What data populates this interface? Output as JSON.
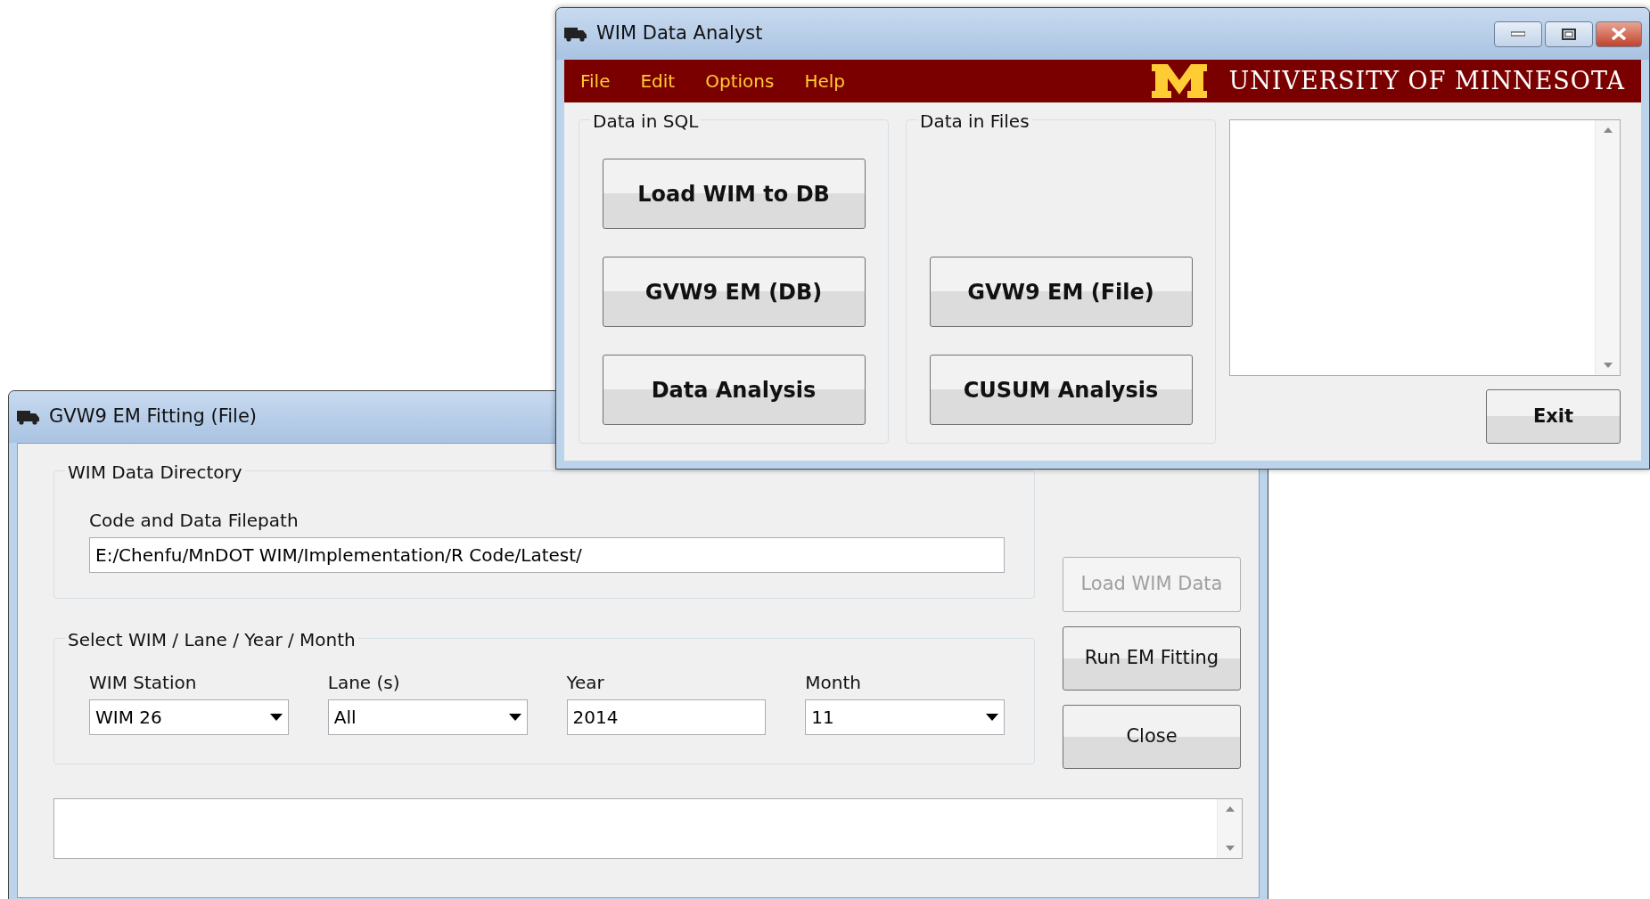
{
  "fitting_window": {
    "title": "GVW9 EM Fitting (File)",
    "directory_group": {
      "title": "WIM Data Directory",
      "label": "Code and Data Filepath",
      "value": "E:/Chenfu/MnDOT WIM/Implementation/R Code/Latest/"
    },
    "select_group": {
      "title": "Select WIM / Lane / Year / Month",
      "fields": [
        {
          "label": "WIM Station",
          "value": "WIM 26",
          "kind": "dropdown"
        },
        {
          "label": "Lane (s)",
          "value": "All",
          "kind": "dropdown"
        },
        {
          "label": "Year",
          "value": "2014",
          "kind": "text"
        },
        {
          "label": "Month",
          "value": "11",
          "kind": "dropdown"
        }
      ]
    },
    "buttons": [
      {
        "label": "Load WIM Data",
        "disabled": true
      },
      {
        "label": "Run EM Fitting",
        "disabled": false
      },
      {
        "label": "Close",
        "disabled": false
      }
    ]
  },
  "main_window": {
    "title": "WIM Data Analyst",
    "menu": [
      "File",
      "Edit",
      "Options",
      "Help"
    ],
    "logo_text": "UNIVERSITY OF MINNESOTA",
    "groups": [
      {
        "title": "Data in SQL",
        "buttons": [
          "Load WIM to DB",
          "GVW9 EM (DB)",
          "Data Analysis"
        ]
      },
      {
        "title": "Data in Files",
        "buttons": [
          "GVW9 EM (File)",
          "CUSUM Analysis"
        ]
      }
    ],
    "exit_button": "Exit"
  }
}
